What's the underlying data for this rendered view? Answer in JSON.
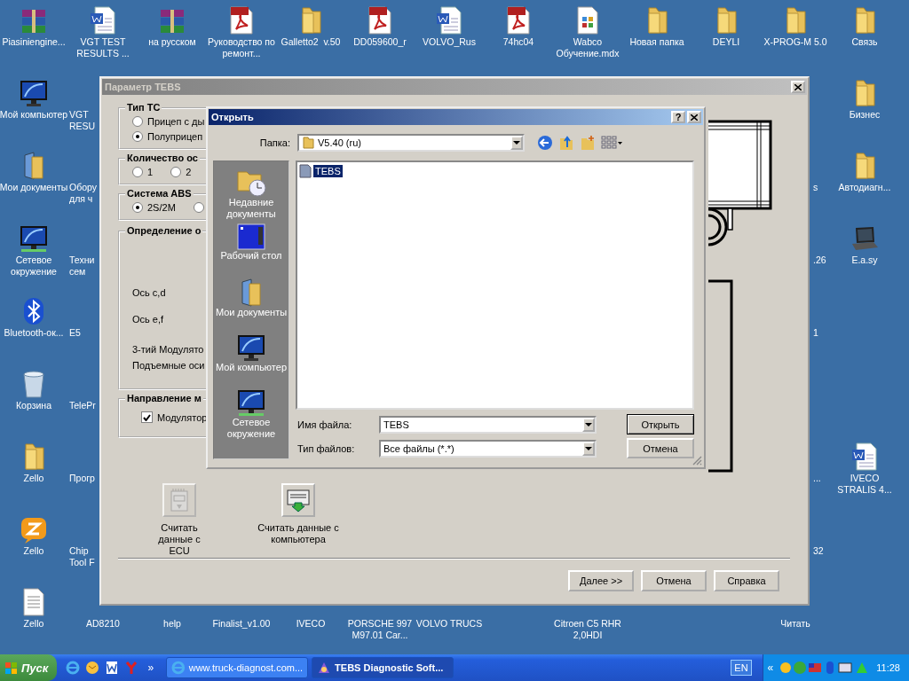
{
  "desktop": {
    "icons": [
      {
        "kind": "archive",
        "label": "Piasiniengine..."
      },
      {
        "kind": "word",
        "label": "VGT TEST RESULTS ..."
      },
      {
        "kind": "archive",
        "label": "на русском"
      },
      {
        "kind": "pdf",
        "label": "Руководство по ремонт..."
      },
      {
        "kind": "folder",
        "label": "Galletto2  v.50"
      },
      {
        "kind": "pdf",
        "label": "DD059600_r"
      },
      {
        "kind": "word",
        "label": "VOLVO_Rus"
      },
      {
        "kind": "pdf",
        "label": "74hc04"
      },
      {
        "kind": "mdx",
        "label": "Wabco Обучение.mdx"
      },
      {
        "kind": "folder",
        "label": "Новая папка"
      },
      {
        "kind": "folder",
        "label": "DEYLI"
      },
      {
        "kind": "folder",
        "label": "X-PROG-M 5.0"
      },
      {
        "kind": "folder",
        "label": "Связь"
      },
      {
        "kind": "monitor",
        "label": "Мой компьютер"
      },
      {
        "kind": "documents",
        "label": "Мои документы"
      },
      {
        "kind": "network",
        "label": "Сетевое окружение"
      },
      {
        "kind": "bluetooth",
        "label": "Bluetooth-ок..."
      },
      {
        "kind": "trash",
        "label": "Корзина"
      },
      {
        "kind": "folder",
        "label": "Zello"
      },
      {
        "kind": "zello",
        "label": "Zello"
      },
      {
        "kind": "text",
        "label": "Zello"
      },
      {
        "kind": "clipped",
        "label": "VGT RESU"
      },
      {
        "kind": "clipped",
        "label": "Обору для ч"
      },
      {
        "kind": "clipped",
        "label": "Техни сем"
      },
      {
        "kind": "clipped",
        "label": "E5"
      },
      {
        "kind": "clipped",
        "label": "TelePr"
      },
      {
        "kind": "clipped",
        "label": "Прогр"
      },
      {
        "kind": "clipped",
        "label": "Chip Tool F"
      },
      {
        "kind": "label-only",
        "label": "AD8210"
      },
      {
        "kind": "label-only",
        "label": "help"
      },
      {
        "kind": "label-only",
        "label": "Finalist_v1.00"
      },
      {
        "kind": "label-only",
        "label": "IVECO"
      },
      {
        "kind": "label-only",
        "label": "PORSCHE 997 M97.01 Car..."
      },
      {
        "kind": "label-only",
        "label": "VOLVO TRUCS"
      },
      {
        "kind": "label-only",
        "label": "Citroen C5 RHR 2,0HDI"
      },
      {
        "kind": "label-only",
        "label": "Читать"
      },
      {
        "kind": "folder",
        "label": "Бизнес"
      },
      {
        "kind": "folder",
        "label": "Автодиагн..."
      },
      {
        "kind": "laptop",
        "label": "E.a.sy"
      },
      {
        "kind": "word",
        "label": "IVECO STRALIS 4..."
      },
      {
        "kind": "clipped",
        "label": "s"
      },
      {
        "kind": "clipped",
        "label": ".26"
      },
      {
        "kind": "clipped",
        "label": "1"
      },
      {
        "kind": "clipped",
        "label": "..."
      },
      {
        "kind": "clipped",
        "label": "32"
      }
    ]
  },
  "main_window": {
    "title": "Параметр TEBS",
    "active": false,
    "groups": [
      {
        "title": "Тип ТС",
        "kind": "radios",
        "options": [
          {
            "label": "Прицеп с ды",
            "selected": false
          },
          {
            "label": "Полуприцеп",
            "selected": true
          }
        ]
      },
      {
        "title": "Количество ос",
        "kind": "radio-row",
        "options": [
          {
            "label": "1",
            "selected": false
          },
          {
            "label": "2",
            "selected": false
          }
        ]
      },
      {
        "title": "Система ABS",
        "kind": "radio-row",
        "options": [
          {
            "label": "2S/2M",
            "selected": true
          },
          {
            "selected": false
          }
        ]
      },
      {
        "title": "Определение о",
        "kind": "labels",
        "items": [
          "Ось c,d",
          "Ось e,f",
          "3-тий Модулято",
          "Подъемные оси"
        ]
      },
      {
        "title": "Направление м",
        "kind": "checks",
        "options": [
          {
            "label": "Модулятор",
            "checked": true
          }
        ]
      }
    ],
    "actions": [
      {
        "label": "Считать данные с ECU",
        "disabled": true
      },
      {
        "label": "Считать данные с компьютера",
        "disabled": false
      }
    ],
    "buttons": [
      "Далее >>",
      "Отмена",
      "Справка"
    ]
  },
  "open_dialog": {
    "title": "Открыть",
    "active": true,
    "help": "?",
    "folder_label": "Папка:",
    "folder": "V5.40 (ru)",
    "places": [
      "Недавние документы",
      "Рабочий стол",
      "Мои документы",
      "Мой компьютер",
      "Сетевое окружение"
    ],
    "files": [
      {
        "name": "TEBS",
        "selected": true
      }
    ],
    "filename_label": "Имя файла:",
    "filename": "TEBS",
    "filetype_label": "Тип файлов:",
    "filetype": "Все файлы (*.*)",
    "buttons": [
      {
        "label": "Открыть",
        "default": true
      },
      {
        "label": "Отмена",
        "default": false
      }
    ]
  },
  "taskbar": {
    "start": "Пуск",
    "more": "»",
    "tasks": [
      {
        "label": "www.truck-diagnost.com...",
        "selected": false
      },
      {
        "label": "TEBS Diagnostic Soft...",
        "selected": true
      }
    ],
    "language": "EN",
    "tray_expand": "«",
    "clock": "11:28"
  }
}
